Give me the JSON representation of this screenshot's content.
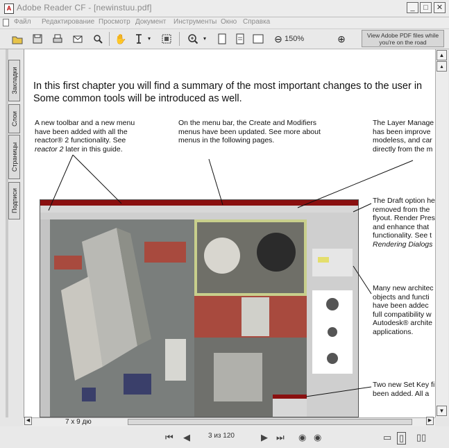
{
  "window": {
    "title": "Adobe Reader CF - [newinstuu.pdf]",
    "buttons": {
      "minimize": "_",
      "maximize": "□",
      "close": "✕"
    }
  },
  "menubar": {
    "items": [
      "Файл",
      "Редактирование",
      "Просмотр",
      "Документ",
      "Инструменты",
      "Окно",
      "Справка"
    ]
  },
  "toolbar": {
    "zoom": "150%",
    "ad_text": "View Adobe PDF files while you're on the road"
  },
  "sidetabs": [
    "Закладки",
    "Слои",
    "Страницы",
    "Подписи"
  ],
  "document": {
    "heading_line1": "In this first chapter you will find a summary of the most important changes to the user in",
    "heading_line2": "Some common tools will be introduced as well.",
    "col1": {
      "line1": "A new toolbar and a new menu",
      "line2": "have been added with all the",
      "line3": "reactor® 2 functionality. See",
      "line4_italic": "reactor 2",
      "line4_rest": " later in this guide."
    },
    "col2": {
      "line1": "On the menu bar, the Create and Modifiers",
      "line2": "menus have been updated. See more about",
      "line3": "menus in the following pages."
    },
    "col3": {
      "line1": "The Layer Manage",
      "line2": "has been improve",
      "line3": "modeless, and car",
      "line4": "directly from the m"
    },
    "note1": {
      "line1": "The Draft option he",
      "line2": "removed from the",
      "line3": "flyout. Render Pres",
      "line4": "and enhance that",
      "line5": "functionality. See t",
      "line6_italic": "Rendering Dialogs"
    },
    "note2": {
      "line1": "Many new architec",
      "line2": "objects and functi",
      "line3": "have been addec",
      "line4": "full compatibility w",
      "line5": "Autodesk® archite",
      "line6": "applications."
    },
    "note3": {
      "line1": "Two new Set Key fi",
      "line2": "been added. All a"
    }
  },
  "hscroll": {
    "page_label": "7 x 9 дю"
  },
  "statusbar": {
    "page_count": "3 из 120"
  }
}
